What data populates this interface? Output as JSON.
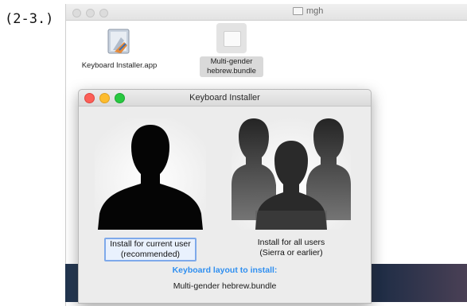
{
  "step_label": "(2-3.)",
  "finder": {
    "title": "mgh",
    "items": [
      {
        "name": "Keyboard Installer.app",
        "icon": "installer-app-icon"
      },
      {
        "name": "Multi-gender hebrew.bundle",
        "icon": "bundle-icon",
        "selected": true
      }
    ]
  },
  "dialog": {
    "title": "Keyboard Installer",
    "options": [
      {
        "line1": "Install for current user",
        "line2": "(recommended)",
        "icon": "single-user-silhouette-icon",
        "focused": true
      },
      {
        "line1": "Install for all users",
        "line2": "(Sierra or earlier)",
        "icon": "group-users-silhouette-icon",
        "focused": false
      }
    ],
    "layout_heading": "Keyboard layout to install:",
    "layout_name": "Multi-gender hebrew.bundle",
    "heading_color": "#2f8ff0"
  }
}
